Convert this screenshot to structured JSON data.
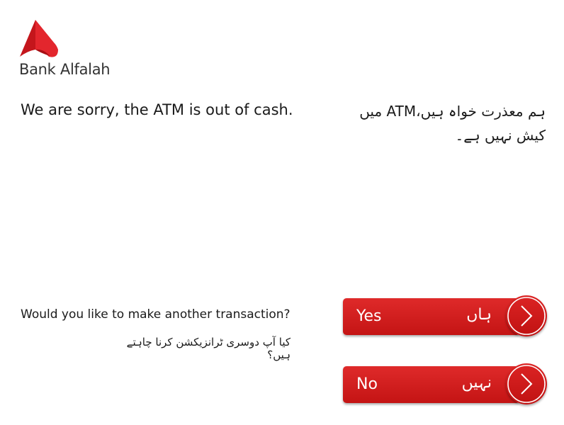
{
  "brand": {
    "name": "Bank Alfalah",
    "accent_color": "#d81f26"
  },
  "messages": {
    "out_of_cash_en": "We are sorry, the ATM is out of cash.",
    "out_of_cash_ur": "ہم معذرت خواہ ہیں،ATM میں کیش نہیں ہے۔",
    "another_transaction_en": "Would you like to make another transaction?",
    "another_transaction_ur": "کیا آپ دوسری ٹرانزیکشن کرنا چاہتے ہیں؟"
  },
  "buttons": {
    "yes": {
      "label_en": "Yes",
      "label_ur": "ہاں",
      "icon": "chevron-right-icon"
    },
    "no": {
      "label_en": "No",
      "label_ur": "نہیں",
      "icon": "chevron-right-icon"
    }
  }
}
